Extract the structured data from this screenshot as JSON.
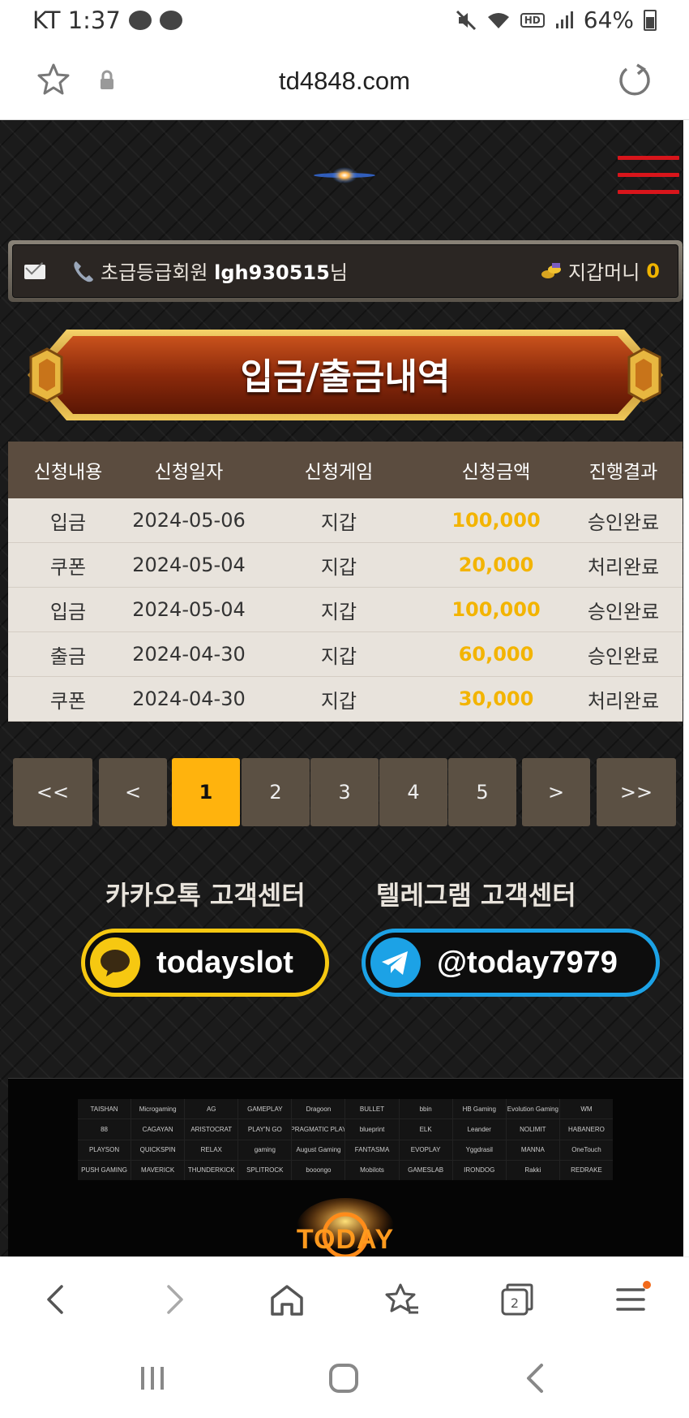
{
  "status": {
    "carrier_time": "KT 1:37",
    "battery": "64%",
    "hd": "HD"
  },
  "browser": {
    "url": "td4848.com",
    "tabs_count": "2"
  },
  "user": {
    "grade": "초급등급회원",
    "username": "lgh930515",
    "suffix": "님",
    "wallet_label": "지갑머니",
    "wallet_value": "0"
  },
  "page_title": "입금/출금내역",
  "table": {
    "headers": [
      "신청내용",
      "신청일자",
      "신청게임",
      "신청금액",
      "진행결과"
    ],
    "rows": [
      [
        "입금",
        "2024-05-06",
        "지갑",
        "100,000",
        "승인완료"
      ],
      [
        "쿠폰",
        "2024-05-04",
        "지갑",
        "20,000",
        "처리완료"
      ],
      [
        "입금",
        "2024-05-04",
        "지갑",
        "100,000",
        "승인완료"
      ],
      [
        "출금",
        "2024-04-30",
        "지갑",
        "60,000",
        "승인완료"
      ],
      [
        "쿠폰",
        "2024-04-30",
        "지갑",
        "30,000",
        "처리완료"
      ]
    ]
  },
  "pagination": {
    "first": "<<",
    "prev": "<",
    "pages": [
      "1",
      "2",
      "3",
      "4",
      "5"
    ],
    "next": ">",
    "last": ">>",
    "current": "1"
  },
  "support": {
    "kakao_label": "카카오톡 고객센터",
    "kakao_id": "todayslot",
    "telegram_label": "텔레그램 고객센터",
    "telegram_id": "@today7979"
  },
  "providers": [
    "TAISHAN",
    "Microgaming",
    "AG",
    "GAMEPLAY",
    "Dragoon",
    "BULLET",
    "bbin",
    "HB Gaming",
    "Evolution Gaming",
    "WM",
    "88",
    "CAGAYAN",
    "ARISTOCRAT",
    "PLAY'N GO",
    "PRAGMATIC PLAY",
    "blueprint",
    "ELK",
    "Leander",
    "NOLIMIT",
    "HABANERO",
    "PLAYSON",
    "QUICKSPIN",
    "RELAX",
    "gaming",
    "August Gaming",
    "FANTASMA",
    "EVOPLAY",
    "Yggdrasil",
    "MANNA",
    "OneTouch",
    "PUSH GAMING",
    "MAVERICK",
    "THUNDERKICK",
    "SPLITROCK",
    "booongo",
    "Mobilots",
    "GAMESLAB",
    "IRONDOG",
    "Rakki",
    "REDRAKE"
  ],
  "footer_logo": "TODAY SLOT",
  "colors": {
    "accent": "#ffb30d",
    "amount": "#f3b400",
    "kakao": "#f6c811",
    "telegram": "#1ca2e6",
    "menu": "#d8151b"
  }
}
